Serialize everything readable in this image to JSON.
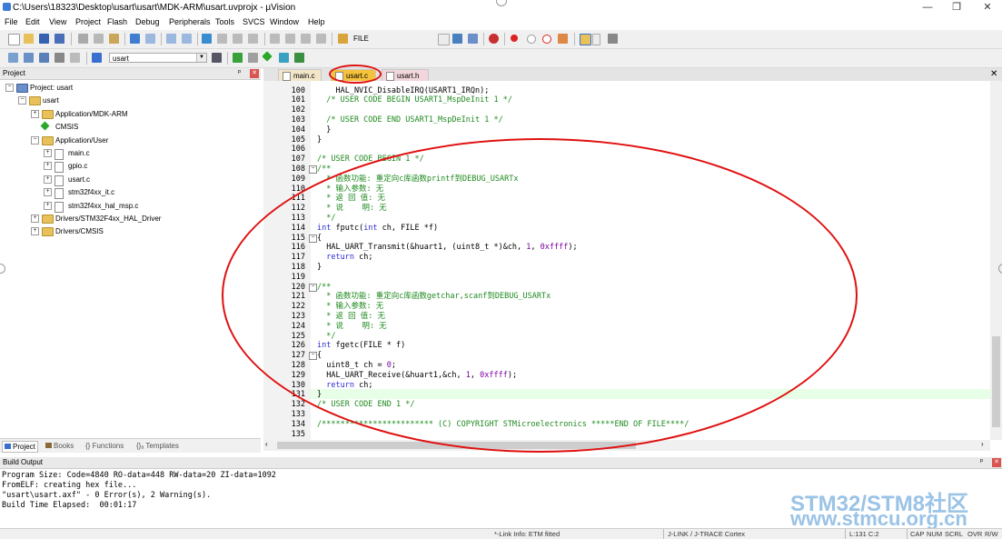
{
  "window": {
    "title": "C:\\Users\\18323\\Desktop\\usart\\usart\\MDK-ARM\\usart.uvprojx - µVision",
    "minimize": "—",
    "maximize": "❐",
    "close": "✕"
  },
  "menu": [
    "File",
    "Edit",
    "View",
    "Project",
    "Flash",
    "Debug",
    "Peripherals",
    "Tools",
    "SVCS",
    "Window",
    "Help"
  ],
  "toolbar": {
    "find_field": "FILE",
    "target_select": "usart"
  },
  "project_pane": {
    "title": "Project",
    "pin": "ᵖ",
    "close": "✕",
    "tree": [
      {
        "label": "Project: usart",
        "level": 0,
        "type": "project",
        "expander": "−"
      },
      {
        "label": "usart",
        "level": 1,
        "type": "folder",
        "expander": "−"
      },
      {
        "label": "Application/MDK-ARM",
        "level": 2,
        "type": "folder",
        "expander": "+"
      },
      {
        "label": "CMSIS",
        "level": 2,
        "type": "cmsis",
        "expander": ""
      },
      {
        "label": "Application/User",
        "level": 2,
        "type": "folder",
        "expander": "−"
      },
      {
        "label": "main.c",
        "level": 3,
        "type": "file",
        "expander": "+"
      },
      {
        "label": "gpio.c",
        "level": 3,
        "type": "file",
        "expander": "+"
      },
      {
        "label": "usart.c",
        "level": 3,
        "type": "file",
        "expander": "+"
      },
      {
        "label": "stm32f4xx_it.c",
        "level": 3,
        "type": "file",
        "expander": "+"
      },
      {
        "label": "stm32f4xx_hal_msp.c",
        "level": 3,
        "type": "file",
        "expander": "+"
      },
      {
        "label": "Drivers/STM32F4xx_HAL_Driver",
        "level": 2,
        "type": "folder",
        "expander": "+"
      },
      {
        "label": "Drivers/CMSIS",
        "level": 2,
        "type": "folder",
        "expander": "+"
      }
    ],
    "tabs": [
      "Project",
      "Books",
      "{} Functions",
      "{}ₐ Templates"
    ]
  },
  "editor": {
    "tabs": [
      "main.c",
      "usart.c",
      "usart.h"
    ],
    "active_tab": "usart.c",
    "close": "✕",
    "dropdown": "▾",
    "lines": [
      {
        "n": "100",
        "text": "    HAL_NVIC_DisableIRQ(USART1_IRQn);",
        "cls": ""
      },
      {
        "n": "101",
        "text": "  /* USER CODE BEGIN USART1_MspDeInit 1 */",
        "cls": "c-cm"
      },
      {
        "n": "102",
        "text": "",
        "cls": ""
      },
      {
        "n": "103",
        "text": "  /* USER CODE END USART1_MspDeInit 1 */",
        "cls": "c-cm"
      },
      {
        "n": "104",
        "text": "  }",
        "cls": ""
      },
      {
        "n": "105",
        "text": "}",
        "cls": ""
      },
      {
        "n": "106",
        "text": "",
        "cls": ""
      },
      {
        "n": "107",
        "text": "/* USER CODE BEGIN 1 */",
        "cls": "c-cm"
      },
      {
        "n": "108",
        "text": "/**",
        "cls": "c-cm"
      },
      {
        "n": "109",
        "text": "  * 函数功能: 重定向c库函数printf到DEBUG_USARTx",
        "cls": "c-cm"
      },
      {
        "n": "110",
        "text": "  * 输入参数: 无",
        "cls": "c-cm"
      },
      {
        "n": "111",
        "text": "  * 返 回 值: 无",
        "cls": "c-cm"
      },
      {
        "n": "112",
        "text": "  * 说    明: 无",
        "cls": "c-cm"
      },
      {
        "n": "113",
        "text": "  */",
        "cls": "c-cm"
      },
      {
        "n": "114",
        "text": "int fputc(int ch, FILE *f)",
        "cls": "fn"
      },
      {
        "n": "115",
        "text": "{",
        "cls": ""
      },
      {
        "n": "116",
        "text": "  HAL_UART_Transmit(&huart1, (uint8_t *)&ch, 1, 0xffff);",
        "cls": ""
      },
      {
        "n": "117",
        "text": "  return ch;",
        "cls": "ret"
      },
      {
        "n": "118",
        "text": "}",
        "cls": ""
      },
      {
        "n": "119",
        "text": "",
        "cls": ""
      },
      {
        "n": "120",
        "text": "/**",
        "cls": "c-cm"
      },
      {
        "n": "121",
        "text": "  * 函数功能: 重定向c库函数getchar,scanf到DEBUG_USARTx",
        "cls": "c-cm"
      },
      {
        "n": "122",
        "text": "  * 输入参数: 无",
        "cls": "c-cm"
      },
      {
        "n": "123",
        "text": "  * 返 回 值: 无",
        "cls": "c-cm"
      },
      {
        "n": "124",
        "text": "  * 说    明: 无",
        "cls": "c-cm"
      },
      {
        "n": "125",
        "text": "  */",
        "cls": "c-cm"
      },
      {
        "n": "126",
        "text": "int fgetc(FILE * f)",
        "cls": "fn2"
      },
      {
        "n": "127",
        "text": "{",
        "cls": ""
      },
      {
        "n": "128",
        "text": "  uint8_t ch = 0;",
        "cls": "num"
      },
      {
        "n": "129",
        "text": "  HAL_UART_Receive(&huart1,&ch, 1, 0xffff);",
        "cls": ""
      },
      {
        "n": "130",
        "text": "  return ch;",
        "cls": "ret"
      },
      {
        "n": "131",
        "text": "}",
        "cls": ""
      },
      {
        "n": "132",
        "text": "/* USER CODE END 1 */",
        "cls": "c-cm"
      },
      {
        "n": "133",
        "text": "",
        "cls": ""
      },
      {
        "n": "134",
        "text": "/************************ (C) COPYRIGHT STMicroelectronics *****END OF FILE****/",
        "cls": "c-cm"
      },
      {
        "n": "135",
        "text": "",
        "cls": ""
      }
    ]
  },
  "build_output": {
    "title": "Build Output",
    "lines": [
      "Program Size: Code=4840 RO-data=448 RW-data=20 ZI-data=1092",
      "FromELF: creating hex file...",
      "\"usart\\usart.axf\" - 0 Error(s), 2 Warning(s).",
      "Build Time Elapsed:  00:01:17"
    ]
  },
  "statusbar": {
    "link_info": "*-Link Info: ETM fitted",
    "debugger": "J-LINK / J-TRACE Cortex",
    "position": "L:131 C:2",
    "caps": "CAP",
    "num": "NUM",
    "scrl": "SCRL",
    "ovr": "OVR",
    "rw": "R/W"
  },
  "watermark": {
    "line1": "STM32/STM8社区",
    "line2": "www.stmcu.org.cn"
  },
  "colors": {
    "annotation": "#e01010",
    "comment": "#1f8a1f",
    "keyword": "#2b2bd8",
    "highlight_line": "#e6ffe6"
  }
}
